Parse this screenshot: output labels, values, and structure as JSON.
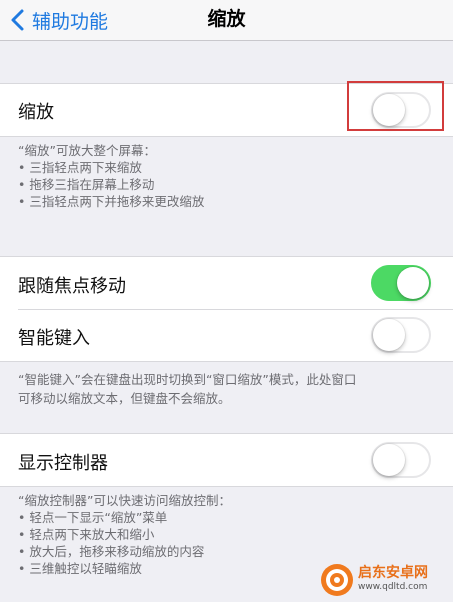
{
  "nav": {
    "back_label": "辅助功能",
    "title": "缩放"
  },
  "zoom_section": {
    "label": "缩放",
    "toggle_on": false,
    "footer_lines": [
      "“缩放”可放大整个屏幕：",
      "• 三指轻点两下来缩放",
      "• 拖移三指在屏幕上移动",
      "• 三指轻点两下并拖移来更改缩放"
    ]
  },
  "focus_section": {
    "rows": [
      {
        "label": "跟随焦点移动",
        "toggle_on": true
      },
      {
        "label": "智能键入",
        "toggle_on": false
      }
    ],
    "footer_lines": [
      "“智能键入”会在键盘出现时切换到“窗口缩放”模式，此处窗口",
      "可移动以缩放文本，但键盘不会缩放。"
    ]
  },
  "controller_section": {
    "label": "显示控制器",
    "toggle_on": false,
    "footer_lines": [
      "“缩放控制器”可以快速访问缩放控制：",
      "• 轻点一下显示“缩放”菜单",
      "• 轻点两下来放大和缩小",
      "• 放大后，拖移来移动缩放的内容",
      "• 三维触控以轻瞄缩放"
    ]
  },
  "colors": {
    "accent": "#1f7ae0",
    "toggle_on": "#4cd964",
    "highlight": "#d23c3c",
    "background": "#efeff4"
  },
  "watermark": {
    "name": "启东安卓网",
    "url": "www.qdltd.com"
  }
}
